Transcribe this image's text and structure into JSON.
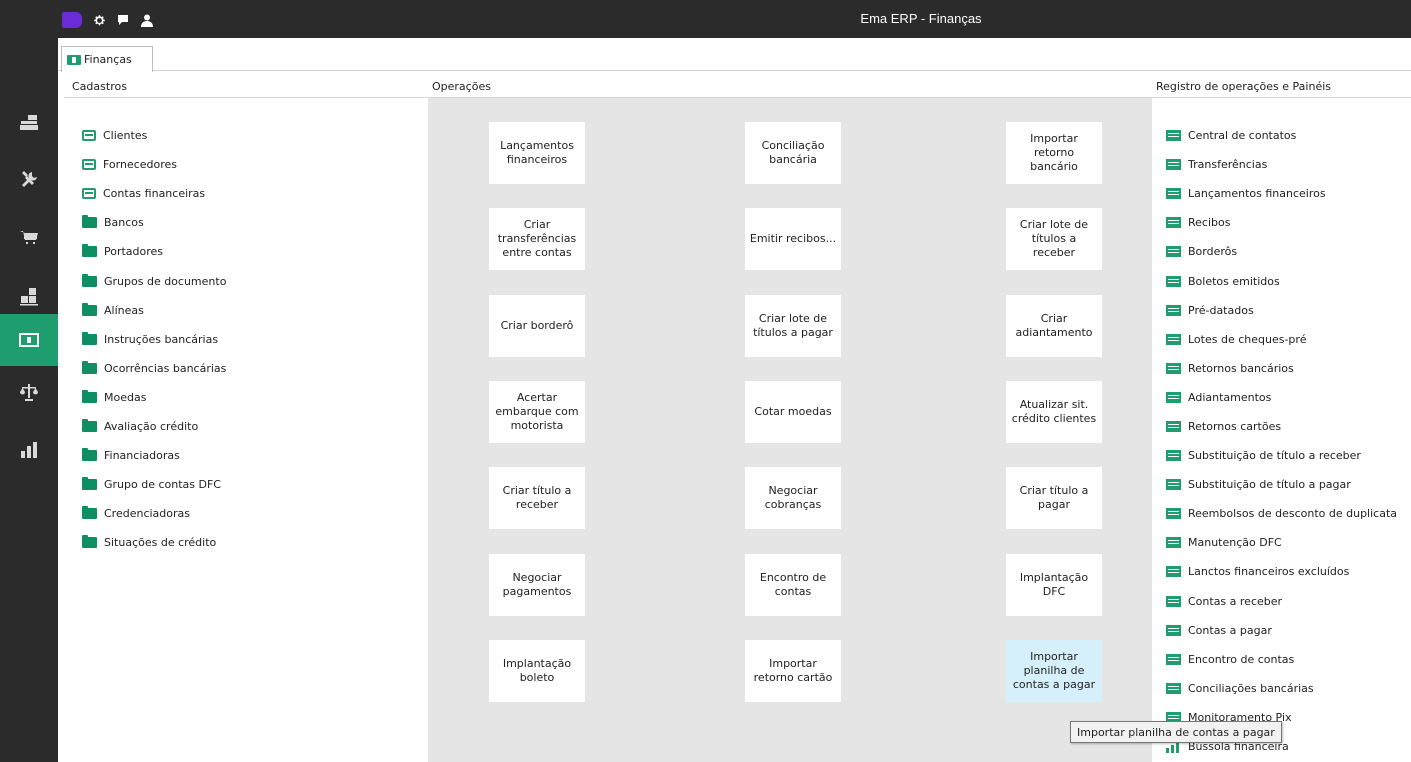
{
  "app": {
    "title": "Ema ERP - Finanças",
    "brand_color": "#6b2bd6",
    "accent_color": "#1e9e6e"
  },
  "titlebar": {
    "icons": [
      "brand-logo-icon",
      "gear-icon",
      "chat-icon",
      "user-icon"
    ]
  },
  "sidebar": {
    "items": [
      {
        "name": "cash-register-icon",
        "active": false
      },
      {
        "name": "tools-icon",
        "active": false
      },
      {
        "name": "cart-icon",
        "active": false
      },
      {
        "name": "stock-boxes-icon",
        "active": false
      },
      {
        "name": "money-icon",
        "active": true
      },
      {
        "name": "scales-icon",
        "active": false
      },
      {
        "name": "bar-chart-icon",
        "active": false
      }
    ]
  },
  "tabs": [
    {
      "label": "Finanças",
      "icon": "money-icon",
      "active": true
    }
  ],
  "cadastros": {
    "header": "Cadastros",
    "items": [
      {
        "label": "Clientes",
        "icon": "card"
      },
      {
        "label": "Fornecedores",
        "icon": "card"
      },
      {
        "label": "Contas financeiras",
        "icon": "card"
      },
      {
        "label": "Bancos",
        "icon": "folder"
      },
      {
        "label": "Portadores",
        "icon": "folder"
      },
      {
        "label": "Grupos de documento",
        "icon": "folder"
      },
      {
        "label": "Alíneas",
        "icon": "folder"
      },
      {
        "label": "Instruções bancárias",
        "icon": "folder"
      },
      {
        "label": "Ocorrências bancárias",
        "icon": "folder"
      },
      {
        "label": "Moedas",
        "icon": "folder"
      },
      {
        "label": "Avaliação crédito",
        "icon": "folder"
      },
      {
        "label": "Financiadoras",
        "icon": "folder"
      },
      {
        "label": "Grupo de contas DFC",
        "icon": "folder"
      },
      {
        "label": "Credenciadoras",
        "icon": "folder"
      },
      {
        "label": "Situações de crédito",
        "icon": "folder"
      }
    ]
  },
  "operacoes": {
    "header": "Operações",
    "columns": [
      [
        "Lançamentos financeiros",
        "Criar transferências entre contas",
        "Criar borderô",
        "Acertar embarque com motorista",
        "Criar título a receber",
        "Negociar pagamentos",
        "Implantação boleto"
      ],
      [
        "Conciliação bancária",
        "Emitir recibos...",
        "Criar lote de títulos a pagar",
        "Cotar moedas",
        "Negociar cobranças",
        "Encontro de contas",
        "Importar retorno cartão"
      ],
      [
        "Importar retorno bancário",
        "Criar lote de títulos a receber",
        "Criar adiantamento",
        "Atualizar sit. crédito clientes",
        "Criar título a pagar",
        "Implantação DFC",
        "Importar planilha de contas a pagar"
      ]
    ],
    "hovered": "Importar planilha de contas a pagar"
  },
  "registro": {
    "header": "Registro de operações e Painéis",
    "items": [
      {
        "label": "Central de contatos",
        "icon": "list"
      },
      {
        "label": "Transferências",
        "icon": "list"
      },
      {
        "label": "Lançamentos financeiros",
        "icon": "list"
      },
      {
        "label": "Recibos",
        "icon": "list"
      },
      {
        "label": "Borderôs",
        "icon": "list"
      },
      {
        "label": "Boletos emitidos",
        "icon": "list"
      },
      {
        "label": "Pré-datados",
        "icon": "list"
      },
      {
        "label": "Lotes de cheques-pré",
        "icon": "list"
      },
      {
        "label": "Retornos bancários",
        "icon": "list"
      },
      {
        "label": "Adiantamentos",
        "icon": "list"
      },
      {
        "label": "Retornos cartões",
        "icon": "list"
      },
      {
        "label": "Substituição de título a receber",
        "icon": "list"
      },
      {
        "label": "Substituição de título a pagar",
        "icon": "list"
      },
      {
        "label": "Reembolsos de desconto de duplicata",
        "icon": "list"
      },
      {
        "label": "Manutenção DFC",
        "icon": "list"
      },
      {
        "label": "Lanctos financeiros excluídos",
        "icon": "list"
      },
      {
        "label": "Contas a receber",
        "icon": "list"
      },
      {
        "label": "Contas a pagar",
        "icon": "list"
      },
      {
        "label": "Encontro de contas",
        "icon": "list"
      },
      {
        "label": "Conciliações bancárias",
        "icon": "list"
      },
      {
        "label": "Monitoramento Pix",
        "icon": "list"
      },
      {
        "label": "Bússola financeira",
        "icon": "bars"
      }
    ]
  },
  "tooltip": {
    "text": "Importar planilha de contas a pagar"
  }
}
